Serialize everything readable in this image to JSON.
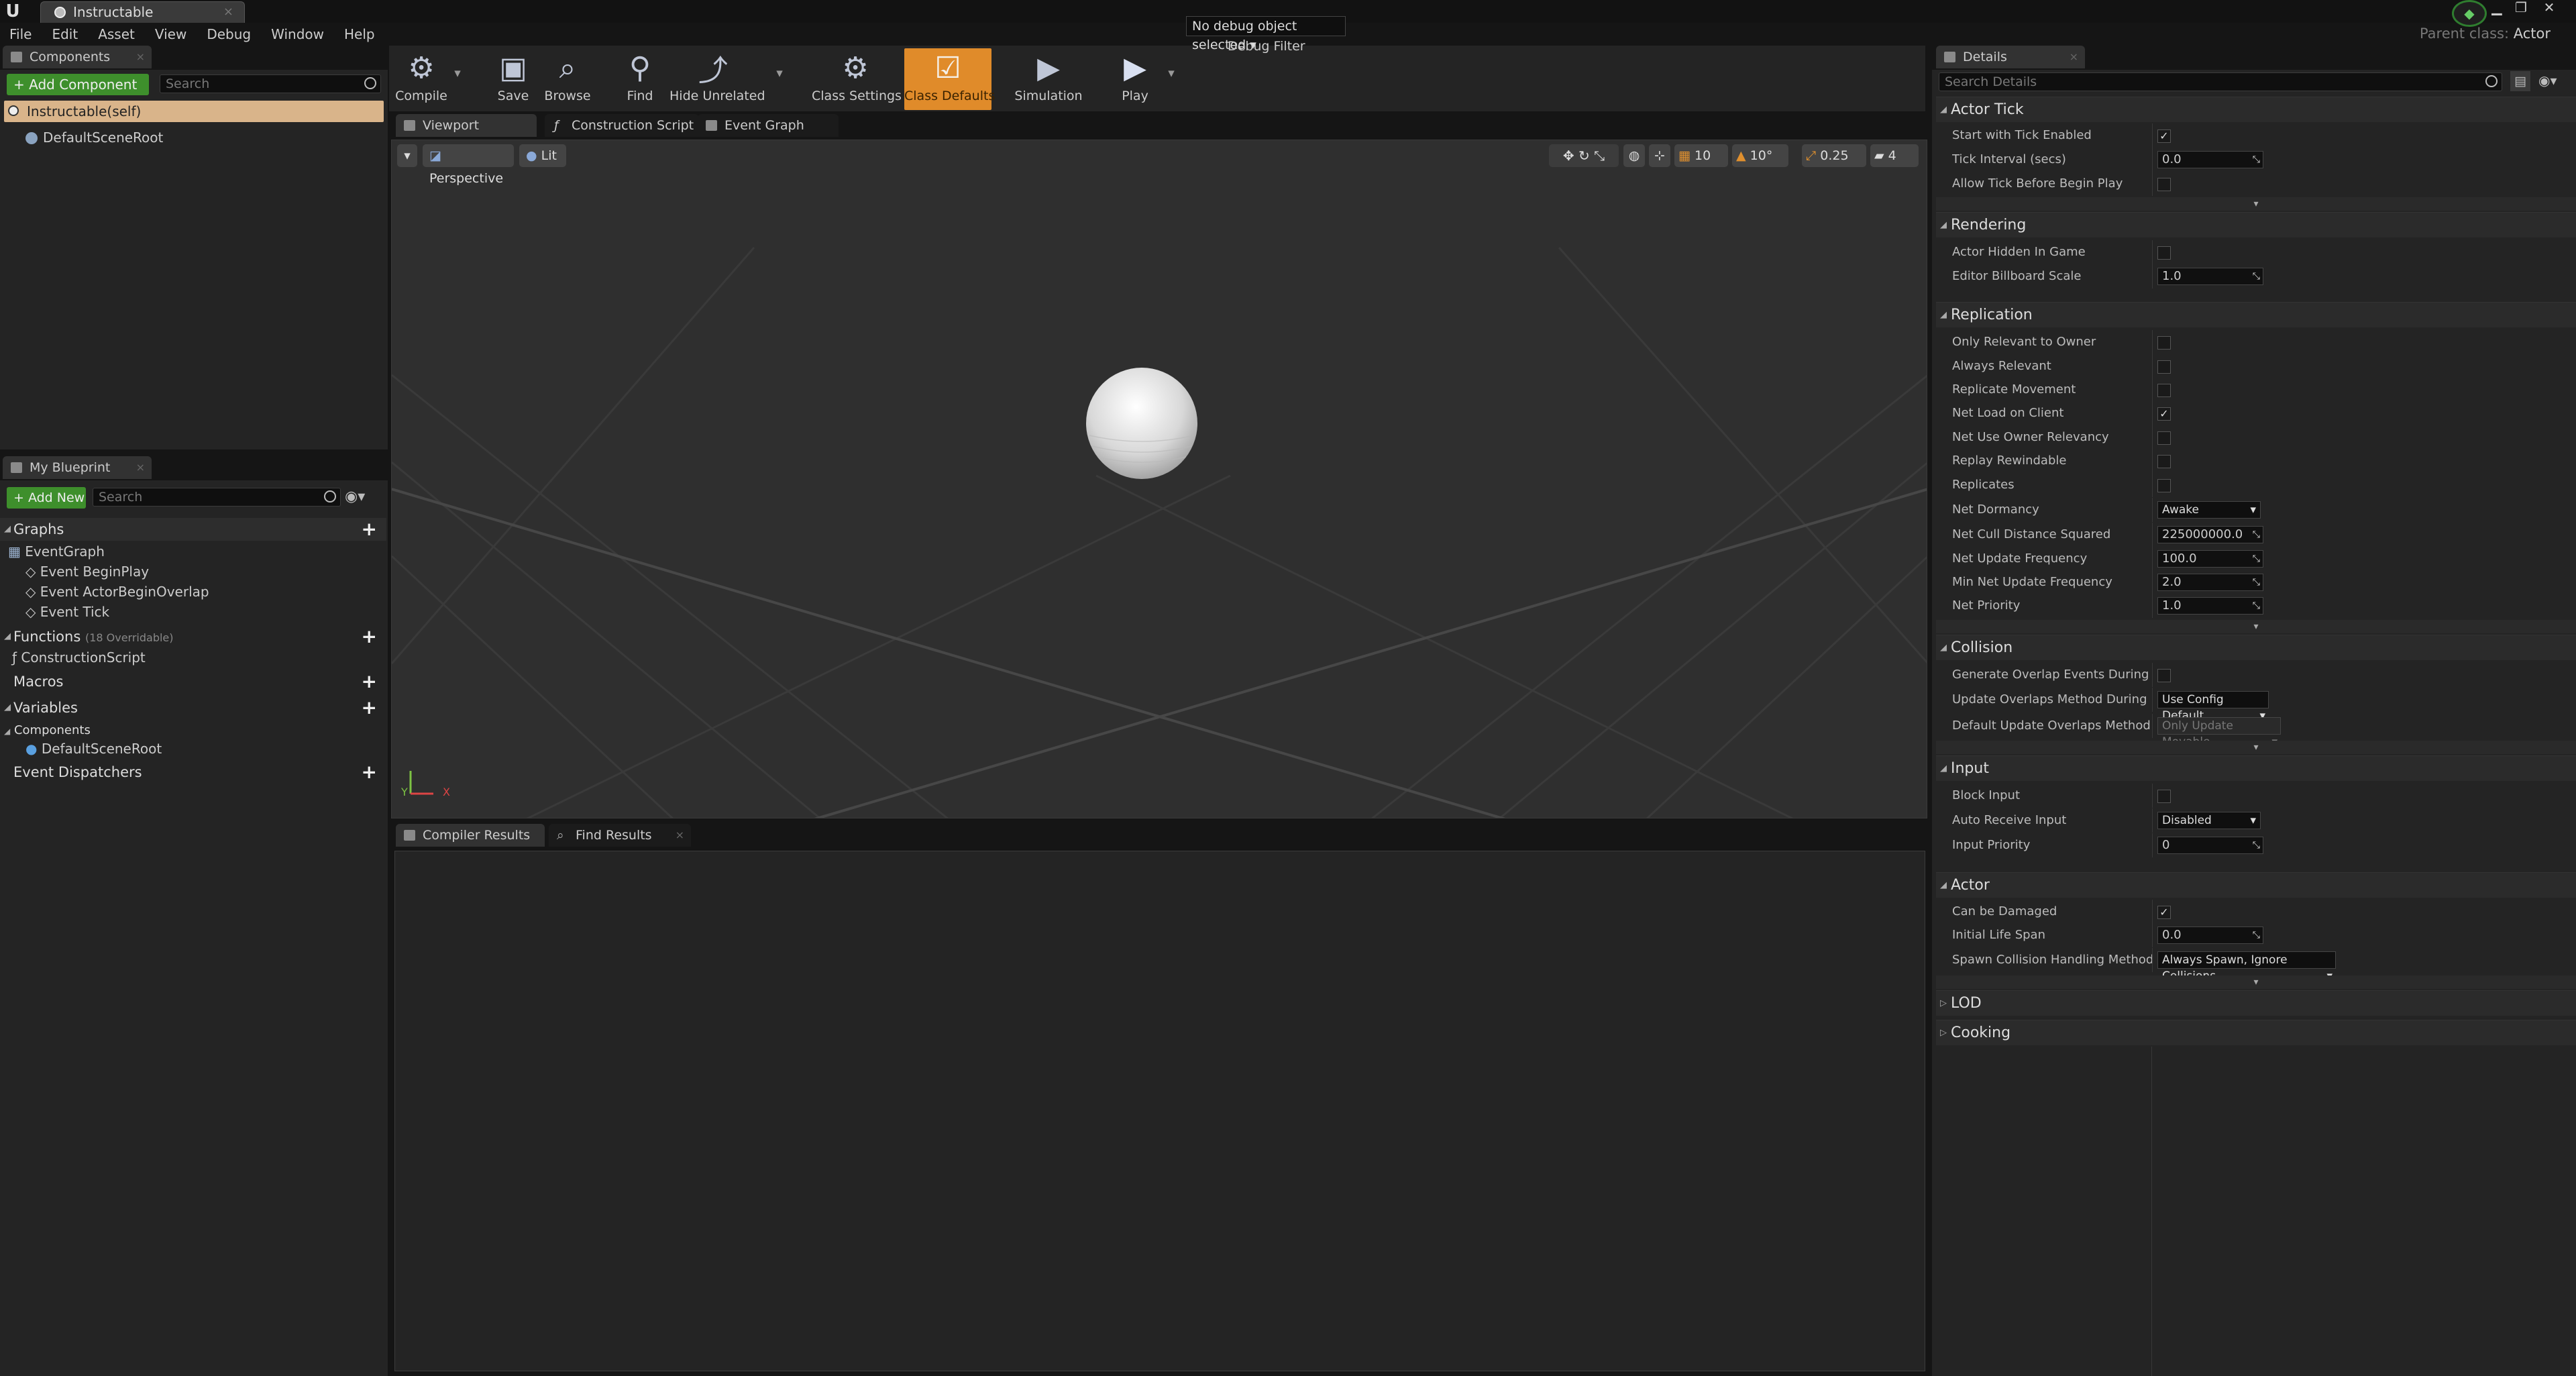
{
  "window": {
    "doc_tab": "Instructable",
    "parent_class_label": "Parent class:",
    "parent_class_value": "Actor"
  },
  "menu": [
    "File",
    "Edit",
    "Asset",
    "View",
    "Debug",
    "Window",
    "Help"
  ],
  "components_panel": {
    "tab": "Components",
    "add_button": "+ Add Component",
    "search_placeholder": "Search",
    "self_item": "Instructable(self)",
    "root_item": "DefaultSceneRoot"
  },
  "my_blueprint": {
    "tab": "My Blueprint",
    "add_new": "+ Add New",
    "search_placeholder": "Search",
    "graphs_label": "Graphs",
    "event_graph": "EventGraph",
    "events": [
      "Event BeginPlay",
      "Event ActorBeginOverlap",
      "Event Tick"
    ],
    "functions_label": "Functions",
    "functions_overridable": "(18 Overridable)",
    "construction_script": "ConstructionScript",
    "macros_label": "Macros",
    "variables_label": "Variables",
    "components_label": "Components",
    "component_root": "DefaultSceneRoot",
    "dispatchers_label": "Event Dispatchers"
  },
  "toolbar": {
    "compile": "Compile",
    "save": "Save",
    "browse": "Browse",
    "find": "Find",
    "hide_unrelated": "Hide Unrelated",
    "class_settings": "Class Settings",
    "class_defaults": "Class Defaults",
    "simulation": "Simulation",
    "play": "Play",
    "debug_select": "No debug object selected",
    "debug_filter": "Debug Filter"
  },
  "editor_tabs": [
    "Viewport",
    "Construction Script",
    "Event Graph"
  ],
  "viewport": {
    "perspective": "Perspective",
    "lit": "Lit",
    "grid_snap": "10",
    "rot_snap": "10°",
    "scale_snap": "0.25",
    "cam_speed": "4",
    "axis_y": "Y",
    "axis_x": "X"
  },
  "bottom_tabs": [
    "Compiler Results",
    "Find Results"
  ],
  "details": {
    "tab": "Details",
    "search_placeholder": "Search Details",
    "sections": {
      "actor_tick": "Actor Tick",
      "rendering": "Rendering",
      "replication": "Replication",
      "collision": "Collision",
      "input": "Input",
      "actor": "Actor",
      "lod": "LOD",
      "cooking": "Cooking"
    },
    "rows": {
      "start_tick": "Start with Tick Enabled",
      "tick_interval": "Tick Interval (secs)",
      "tick_interval_val": "0.0",
      "allow_tick": "Allow Tick Before Begin Play",
      "hidden_in_game": "Actor Hidden In Game",
      "billboard_scale": "Editor Billboard Scale",
      "billboard_scale_val": "1.0",
      "only_relevant_owner": "Only Relevant to Owner",
      "always_relevant": "Always Relevant",
      "replicate_movement": "Replicate Movement",
      "net_load_client": "Net Load on Client",
      "net_use_owner": "Net Use Owner Relevancy",
      "replay_rewindable": "Replay Rewindable",
      "replicates": "Replicates",
      "net_dormancy": "Net Dormancy",
      "net_dormancy_val": "Awake",
      "net_cull": "Net Cull Distance Squared",
      "net_cull_val": "225000000.0",
      "net_update_freq": "Net Update Frequency",
      "net_update_freq_val": "100.0",
      "min_net_update": "Min Net Update Frequency",
      "min_net_update_val": "2.0",
      "net_priority": "Net Priority",
      "net_priority_val": "1.0",
      "gen_overlap": "Generate Overlap Events During Level Stre",
      "update_overlaps": "Update Overlaps Method During Level Stre",
      "update_overlaps_val": "Use Config Default",
      "default_update": "Default Update Overlaps Method During Le",
      "default_update_val": "Only Update Movable",
      "block_input": "Block Input",
      "auto_receive": "Auto Receive Input",
      "auto_receive_val": "Disabled",
      "input_priority": "Input Priority",
      "input_priority_val": "0",
      "can_be_damaged": "Can be Damaged",
      "initial_life": "Initial Life Span",
      "initial_life_val": "0.0",
      "spawn_collision": "Spawn Collision Handling Method",
      "spawn_collision_val": "Always Spawn, Ignore Collisions"
    }
  }
}
